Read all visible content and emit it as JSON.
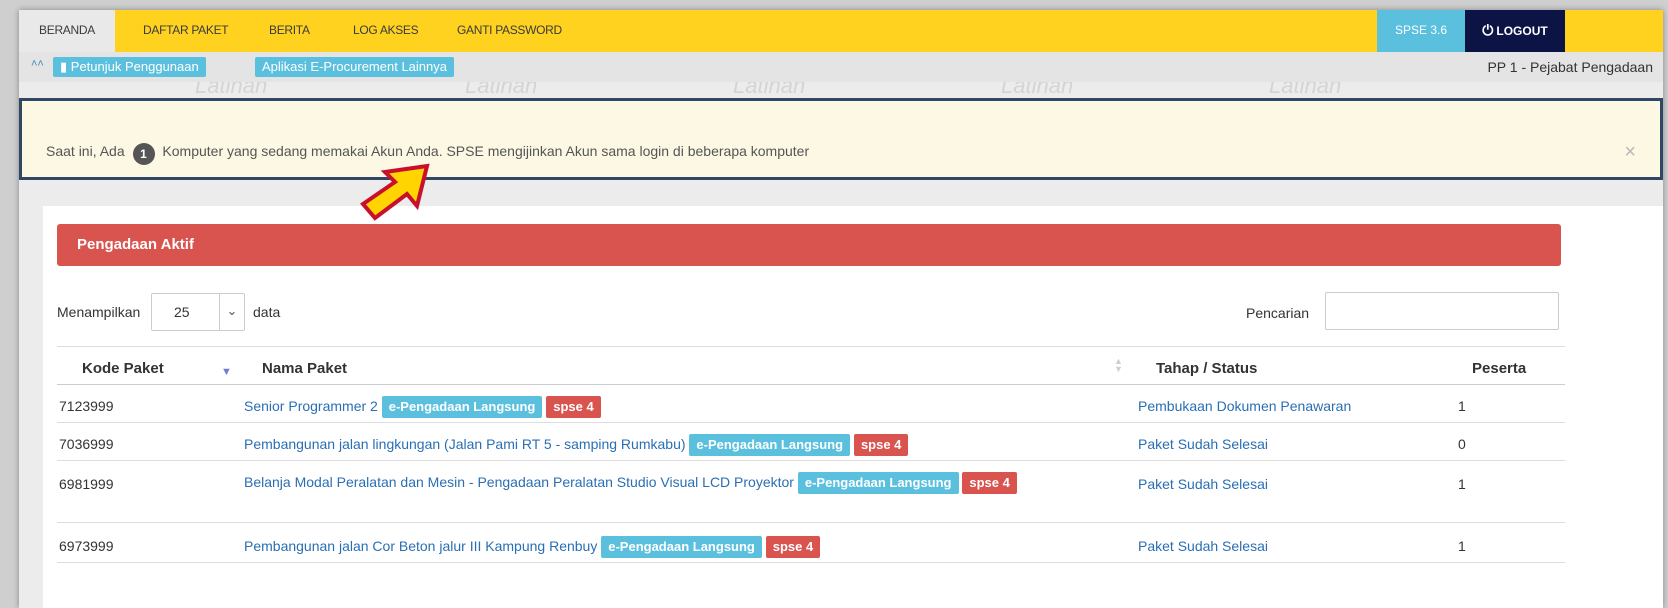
{
  "nav": {
    "items": [
      "BERANDA",
      "DAFTAR PAKET",
      "BERITA",
      "LOG AKSES",
      "GANTI PASSWORD"
    ],
    "version": "SPSE 3.6",
    "logout": "LOGOUT"
  },
  "subbar": {
    "help_label": "Petunjuk Penggunaan",
    "other_apps_label": "Aplikasi E-Procurement Lainnya",
    "role": "PP 1 - Pejabat Pengadaan"
  },
  "watermark": "Latihan",
  "alert": {
    "prefix": "Saat ini, Ada",
    "count": "1",
    "suffix": "Komputer yang sedang memakai Akun Anda. SPSE mengijinkan Akun sama login di beberapa komputer",
    "close": "×"
  },
  "panel": {
    "title": "Pengadaan Aktif",
    "show_label": "Menampilkan",
    "page_size": "25",
    "data_label": "data",
    "search_label": "Pencarian",
    "search_value": ""
  },
  "table": {
    "headers": [
      "Kode Paket",
      "Nama Paket",
      "Tahap / Status",
      "Peserta"
    ],
    "rows": [
      {
        "kode": "7123999",
        "nama": "Senior Programmer 2",
        "method": "e-Pengadaan Langsung",
        "spse": "spse 4",
        "status": "Pembukaan Dokumen Penawaran",
        "peserta": "1"
      },
      {
        "kode": "7036999",
        "nama": "Pembangunan jalan lingkungan (Jalan Pami RT 5 - samping Rumkabu)",
        "method": "e-Pengadaan Langsung",
        "spse": "spse 4",
        "status": "Paket Sudah Selesai",
        "peserta": "0"
      },
      {
        "kode": "6981999",
        "nama": "Belanja Modal Peralatan dan Mesin - Pengadaan Peralatan Studio Visual LCD Proyektor",
        "method": "e-Pengadaan Langsung",
        "spse": "spse 4",
        "status": "Paket Sudah Selesai",
        "peserta": "1"
      },
      {
        "kode": "6973999",
        "nama": "Pembangunan jalan Cor Beton jalur III Kampung Renbuy",
        "method": "e-Pengadaan Langsung",
        "spse": "spse 4",
        "status": "Paket Sudah Selesai",
        "peserta": "1"
      }
    ]
  },
  "colors": {
    "nav_bg": "#ffd21f",
    "logout_bg": "#0b1445",
    "info": "#5bc0de",
    "danger": "#d9534f",
    "alert_bg": "#fcf8e3",
    "highlight_border": "#2f4763",
    "arrow_fill": "#ffd400",
    "arrow_stroke": "#c8102e"
  },
  "icons": {
    "chevron": "chevron-up-double-icon",
    "book": "book-icon",
    "power": "power-icon",
    "close": "close-icon",
    "arrow": "pointer-arrow-icon"
  }
}
